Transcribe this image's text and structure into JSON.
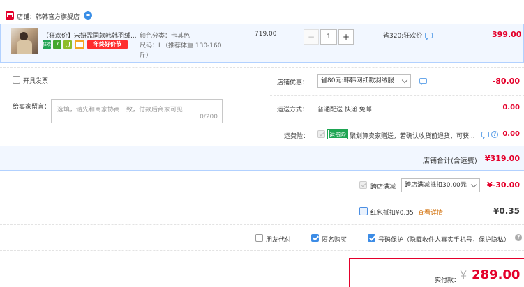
{
  "shop": {
    "label": "店铺：韩韩官方旗舰店"
  },
  "item": {
    "title": "【狂欢价】宋妍霏同款韩韩羽绒...",
    "tags": [
      "狂欢",
      "7",
      "",
      "",
      "年终好价节"
    ],
    "color_spec": "颜色分类：卡其色",
    "size_spec": "尺码：L（推荐体重 130-160斤）",
    "unit_price": "719.00",
    "quantity": "1",
    "minus": "−",
    "plus": "+",
    "saving": "省320:狂欢价",
    "subtotal": "399.00"
  },
  "invoice": {
    "label": "开具发票"
  },
  "message": {
    "label": "给卖家留言：",
    "placeholder": "选填，请先和商家协商一致，付款后商家可见",
    "counter": "0/200"
  },
  "shop_discount": {
    "label": "店铺优惠：",
    "selected": "省80元:韩韩网红款羽绒服",
    "amount": "-80.00"
  },
  "shipping": {
    "label": "运送方式：",
    "value": "普通配送 快递 免邮",
    "amount": "0.00"
  },
  "insurance": {
    "label": "运费险：",
    "badge": "运费险",
    "text": "聚划算卖家赠送，若确认收货前退货，可获...",
    "help": "?",
    "amount": "0.00"
  },
  "shop_total": {
    "label": "店铺合计(含运费)",
    "amount": "¥319.00"
  },
  "cross_store": {
    "label": "跨店满减",
    "selected": "跨店满减抵扣30.00元",
    "amount": "¥-30.00"
  },
  "red_packet": {
    "label": "红包抵扣¥0.35",
    "link": "查看详情",
    "amount": "¥0.35"
  },
  "options": {
    "friend_pay": "朋友代付",
    "anonymous": "匿名购买",
    "privacy": "号码保护（隐藏收件人真实手机号，保护隐私）",
    "help": "?"
  },
  "payment": {
    "label": "实付款：",
    "currency": "¥",
    "amount": "289.00"
  },
  "colors": {
    "accent": "#e4002b",
    "highlight_bg": "#f2f7ff",
    "highlight_border": "#b2d1ff",
    "link": "#d06b00"
  }
}
